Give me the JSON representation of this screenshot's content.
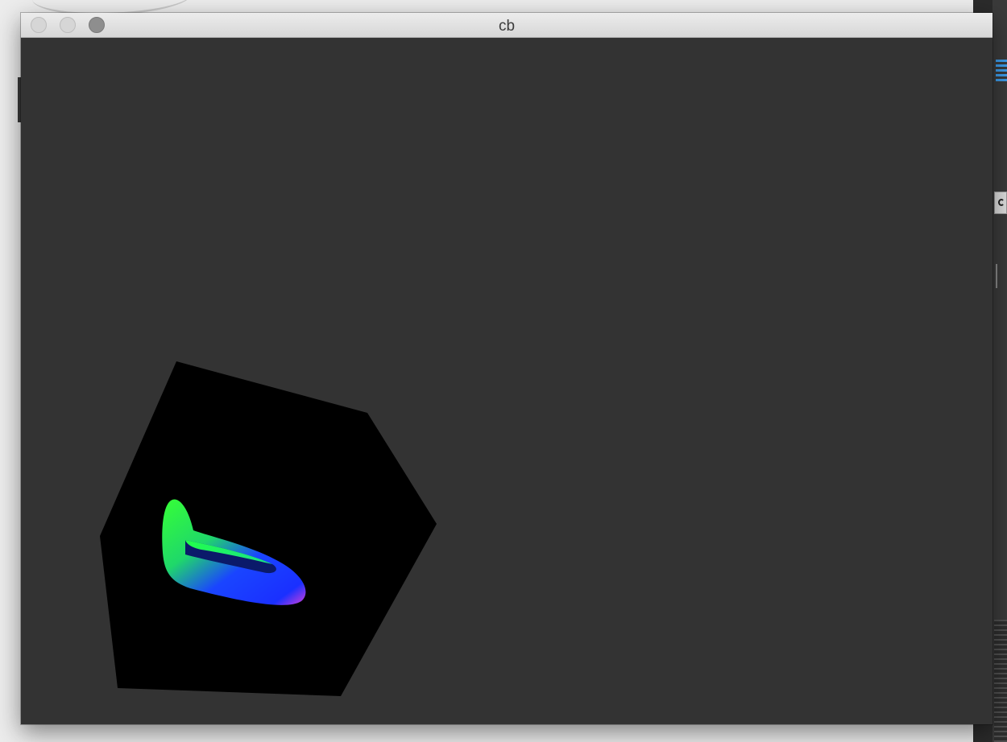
{
  "window": {
    "title": "cb",
    "background_color": "#333333",
    "controls": {
      "close": "close-icon",
      "minimize": "minimize-icon",
      "zoom": "zoom-icon"
    }
  },
  "scene": {
    "cube_color": "#000000",
    "torus_gradient": [
      "#2dff2d",
      "#1a3dff",
      "#d13bd6"
    ]
  }
}
